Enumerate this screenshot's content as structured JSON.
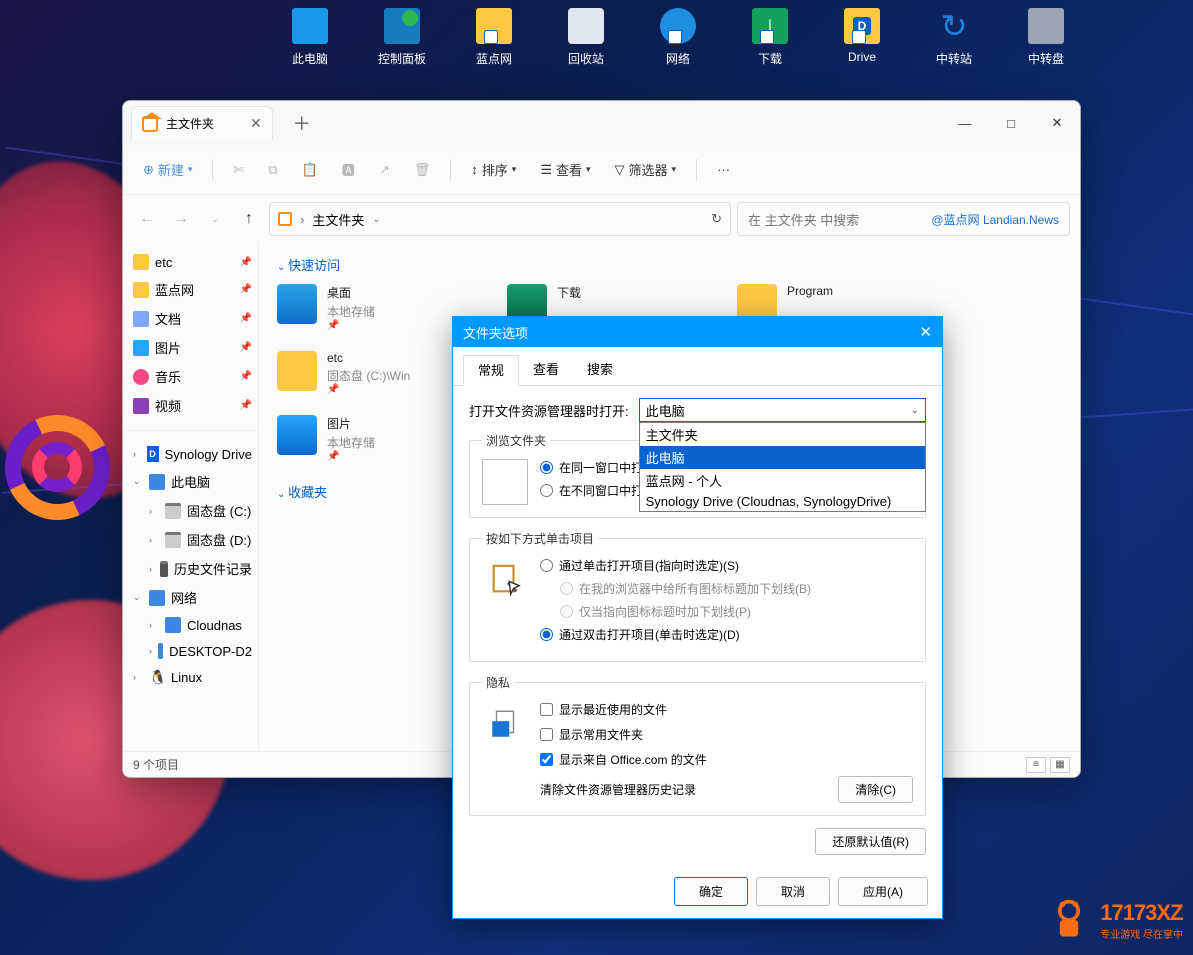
{
  "desktop": {
    "icons": [
      {
        "label": "此电脑",
        "icon": "pc"
      },
      {
        "label": "控制面板",
        "icon": "ctrl"
      },
      {
        "label": "蓝点网",
        "icon": "folder",
        "shortcut": true
      },
      {
        "label": "回收站",
        "icon": "bin"
      },
      {
        "label": "网络",
        "icon": "net",
        "shortcut": true
      },
      {
        "label": "下载",
        "icon": "dl",
        "shortcut": true
      },
      {
        "label": "Drive",
        "icon": "drive",
        "shortcut": true
      },
      {
        "label": "中转站",
        "icon": "sync"
      },
      {
        "label": "中转盘",
        "icon": "disk"
      }
    ]
  },
  "explorer": {
    "tab_title": "主文件夹",
    "newtab": "＋",
    "win_min": "—",
    "win_max": "□",
    "win_close": "✕",
    "toolbar": {
      "new": "新建",
      "sort": "排序",
      "view": "查看",
      "filter": "筛选器",
      "more": "···"
    },
    "breadcrumb": "主文件夹",
    "search_placeholder": "在 主文件夹 中搜索",
    "watermark": "@蓝点网 Landian.News",
    "nav": {
      "pins": [
        {
          "label": "etc",
          "icon": "folder"
        },
        {
          "label": "蓝点网",
          "icon": "folder"
        },
        {
          "label": "文档",
          "icon": "doc"
        },
        {
          "label": "图片",
          "icon": "pic"
        },
        {
          "label": "音乐",
          "icon": "music"
        },
        {
          "label": "视频",
          "icon": "video"
        }
      ],
      "syn_label": "Synology Drive",
      "pc_label": "此电脑",
      "drives": [
        {
          "label": "固态盘 (C:)"
        },
        {
          "label": "固态盘 (D:)"
        },
        {
          "label": "历史文件记录"
        }
      ],
      "net_label": "网络",
      "net_items": [
        {
          "label": "Cloudnas"
        },
        {
          "label": "DESKTOP-D2"
        }
      ],
      "linux_label": "Linux"
    },
    "groups": {
      "quick": "快速访问",
      "fav": "收藏夹"
    },
    "items": [
      {
        "title": "桌面",
        "sub": "本地存储",
        "icon": "desk",
        "pin": true
      },
      {
        "title": "下载",
        "sub": "",
        "icon": "dl"
      },
      {
        "title": "Program",
        "sub": "",
        "icon": "fold"
      },
      {
        "title": "etc",
        "sub": "固态盘 (C:)\\Win",
        "icon": "fold",
        "pin": true
      },
      {
        "title": "图片",
        "sub": "本地存储",
        "icon": "pic",
        "pin": true
      }
    ],
    "status": "9 个项目"
  },
  "dialog": {
    "title": "文件夹选项",
    "tabs": [
      "常规",
      "查看",
      "搜索"
    ],
    "open_label": "打开文件资源管理器时打开:",
    "selected": "此电脑",
    "options": [
      "主文件夹",
      "此电脑",
      "蓝点网 - 个人",
      "Synology Drive (Cloudnas, SynologyDrive)"
    ],
    "grp_browse": "浏览文件夹",
    "browse_r1": "在同一窗口中打开每个",
    "browse_r2": "在不同窗口中打开不同",
    "grp_click": "按如下方式单击项目",
    "click_r1": "通过单击打开项目(指向时选定)(S)",
    "click_r1a": "在我的浏览器中给所有图标标题加下划线(B)",
    "click_r1b": "仅当指向图标标题时加下划线(P)",
    "click_r2": "通过双击打开项目(单击时选定)(D)",
    "grp_priv": "隐私",
    "priv_c1": "显示最近使用的文件",
    "priv_c2": "显示常用文件夹",
    "priv_c3": "显示来自 Office.com 的文件",
    "clear_label": "清除文件资源管理器历史记录",
    "clear_btn": "清除(C)",
    "restore": "还原默认值(R)",
    "ok": "确定",
    "cancel": "取消",
    "apply": "应用(A)"
  },
  "wm": {
    "text": "17173XZ",
    "sub": "专业游戏 尽在掌中"
  }
}
